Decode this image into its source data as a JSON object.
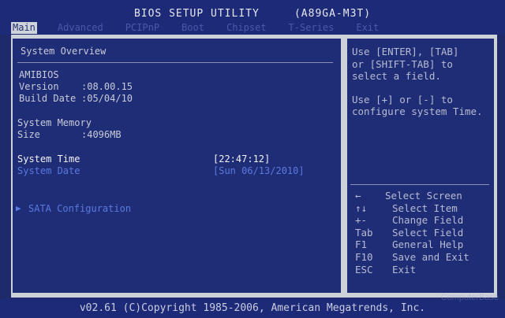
{
  "header": {
    "title": "BIOS SETUP UTILITY",
    "model": "(A89GA-M3T)"
  },
  "tabs": [
    "Main",
    "Advanced",
    "PCIPnP",
    "Boot",
    "Chipset",
    "T-Series",
    "Exit"
  ],
  "active_tab": "Main",
  "main": {
    "section_title": "System Overview",
    "amibios_label": "AMIBIOS",
    "version_label": "Version",
    "version_value": ":08.00.15",
    "build_date_label": "Build Date",
    "build_date_value": ":05/04/10",
    "memory_title": "System Memory",
    "size_label": "Size",
    "size_value": ":4096MB",
    "system_time_label": "System Time",
    "system_time_value": "[22:47:12]",
    "system_date_label": "System Date",
    "system_date_value": "[Sun 06/13/2010]",
    "sata_arrow": "▶",
    "sata_label": "SATA Configuration"
  },
  "help": {
    "line1": "Use [ENTER], [TAB]",
    "line2": "or [SHIFT-TAB] to",
    "line3": "select a field.",
    "line4": "Use [+] or [-] to",
    "line5": "configure system Time."
  },
  "legend": [
    {
      "key": "←",
      "desc": "Select Screen"
    },
    {
      "key": "↑↓",
      "desc": "Select Item"
    },
    {
      "key": "+-",
      "desc": "Change Field"
    },
    {
      "key": "Tab",
      "desc": "Select Field"
    },
    {
      "key": "F1",
      "desc": "General Help"
    },
    {
      "key": "F10",
      "desc": "Save and Exit"
    },
    {
      "key": "ESC",
      "desc": "Exit"
    }
  ],
  "footer": "v02.61 (C)Copyright 1985-2006, American Megatrends, Inc.",
  "watermark": "ComputerBase"
}
